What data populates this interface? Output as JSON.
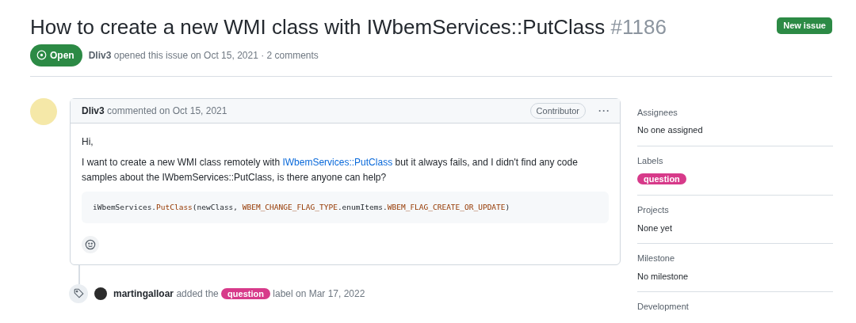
{
  "issue": {
    "title": "How to create a new WMI class with IWbemServices::PutClass",
    "number": "#1186",
    "state": {
      "label": "Open",
      "kind": "open"
    },
    "author": "Dliv3",
    "meta": "opened this issue on Oct 15, 2021 · 2 comments"
  },
  "new_issue_button": "New issue",
  "comment": {
    "author": "Dliv3",
    "meta": "commented on Oct 15, 2021",
    "role": "Contributor",
    "menu": "···",
    "greeting": "Hi,",
    "paragraph": [
      {
        "kind": "text",
        "text": "I want to create a new WMI class remotely with "
      },
      {
        "kind": "link",
        "text": "IWbemServices::PutClass"
      },
      {
        "kind": "text",
        "text": " but it always fails, and I didn't find any code samples about the IWbemServices::PutClass, is there anyone can help?"
      }
    ],
    "code": [
      {
        "kind": "plain",
        "text": "iWbemServices."
      },
      {
        "kind": "func",
        "text": "PutClass"
      },
      {
        "kind": "plain",
        "text": "(newClass, "
      },
      {
        "kind": "const",
        "text": "WBEM_CHANGE_FLAG_TYPE"
      },
      {
        "kind": "plain",
        "text": ".enumItems."
      },
      {
        "kind": "const",
        "text": "WBEM_FLAG_CREATE_OR_UPDATE"
      },
      {
        "kind": "plain",
        "text": ")"
      }
    ]
  },
  "event": {
    "actor": "martingalloar",
    "before": "added the",
    "label": {
      "text": "question",
      "color": "#d73a8a"
    },
    "after": "label on Mar 17, 2022"
  },
  "sidebar": [
    {
      "heading": "Assignees",
      "kind": "text",
      "value": "No one assigned"
    },
    {
      "heading": "Labels",
      "kind": "label",
      "value": "question",
      "color": "#d73a8a"
    },
    {
      "heading": "Projects",
      "kind": "text",
      "value": "None yet"
    },
    {
      "heading": "Milestone",
      "kind": "text",
      "value": "No milestone"
    },
    {
      "heading": "Development",
      "kind": "heading-only"
    }
  ]
}
